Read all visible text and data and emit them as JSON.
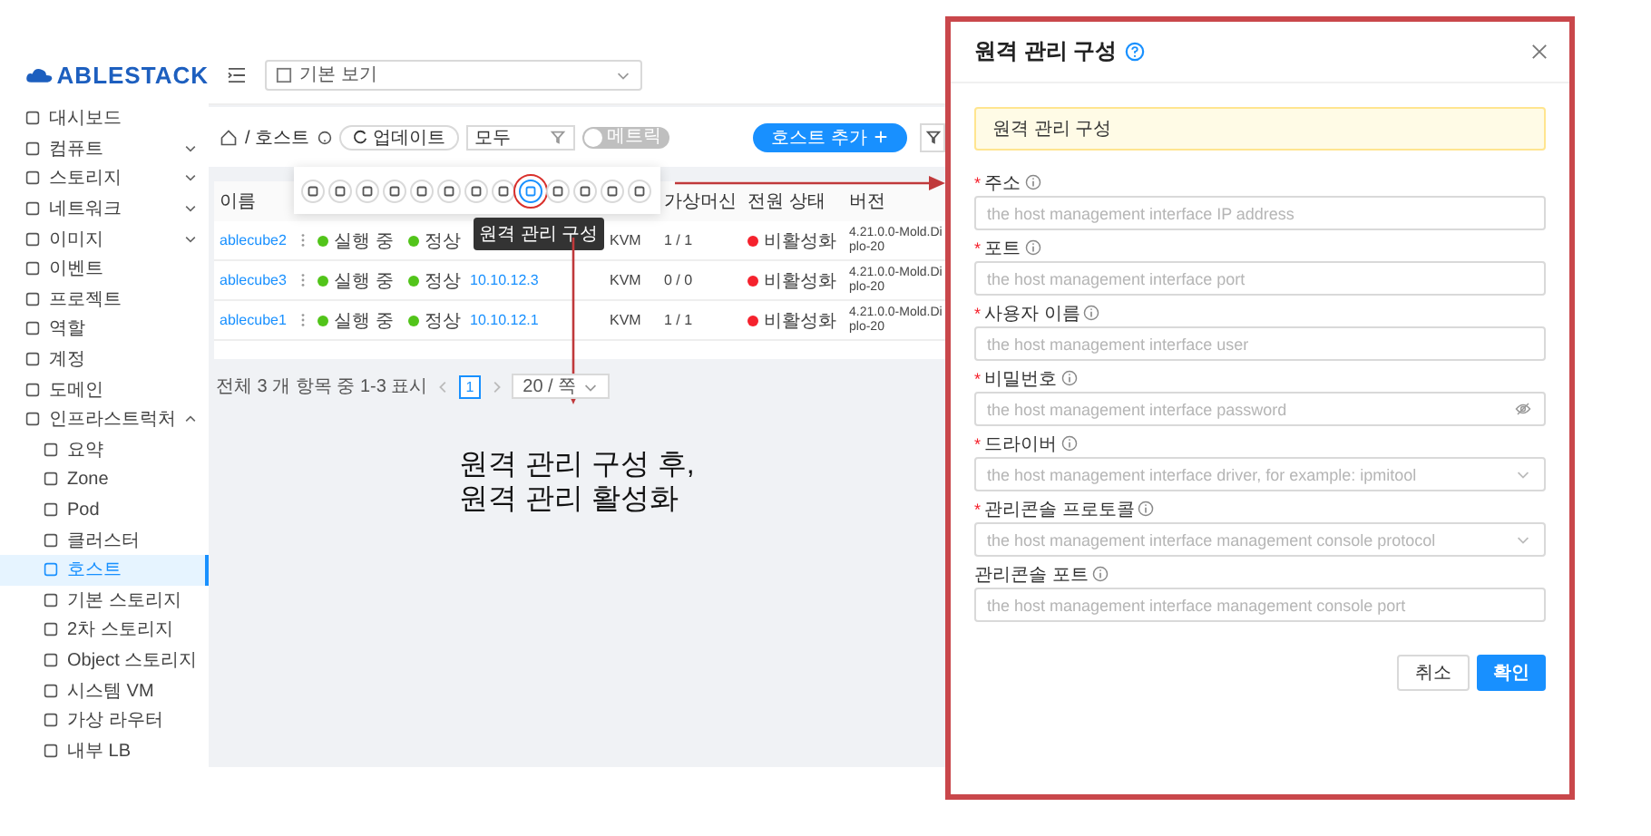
{
  "sidebar": {
    "logo": "ABLESTACK",
    "items": [
      {
        "label": "대시보드",
        "kind": "link",
        "selected": false
      },
      {
        "label": "컴퓨트",
        "kind": "group",
        "expanded": false,
        "selected": false
      },
      {
        "label": "스토리지",
        "kind": "group",
        "expanded": false,
        "selected": false
      },
      {
        "label": "네트워크",
        "kind": "group",
        "expanded": false,
        "selected": false
      },
      {
        "label": "이미지",
        "kind": "group",
        "expanded": false,
        "selected": false
      },
      {
        "label": "이벤트",
        "kind": "link",
        "selected": false
      },
      {
        "label": "프로젝트",
        "kind": "link",
        "selected": false
      },
      {
        "label": "역할",
        "kind": "link",
        "selected": false
      },
      {
        "label": "계정",
        "kind": "link",
        "selected": false
      },
      {
        "label": "도메인",
        "kind": "link",
        "selected": false
      },
      {
        "label": "인프라스트럭처",
        "kind": "group",
        "expanded": true,
        "selected": false,
        "children": [
          {
            "label": "요약",
            "selected": false
          },
          {
            "label": "Zone",
            "selected": false
          },
          {
            "label": "Pod",
            "selected": false
          },
          {
            "label": "클러스터",
            "selected": false
          },
          {
            "label": "호스트",
            "selected": true
          },
          {
            "label": "기본 스토리지",
            "selected": false
          },
          {
            "label": "2차 스토리지",
            "selected": false
          },
          {
            "label": "Object 스토리지",
            "selected": false
          },
          {
            "label": "시스템 VM",
            "selected": false
          },
          {
            "label": "가상 라우터",
            "selected": false
          },
          {
            "label": "내부 LB",
            "selected": false
          }
        ]
      }
    ]
  },
  "header": {
    "view_select": "기본 보기"
  },
  "toolbar": {
    "breadcrumb": "/ 호스트",
    "refresh_button": "업데이트",
    "filter_select": "모두",
    "metrics_toggle": {
      "label": "메트릭",
      "on": false
    },
    "add_button": "호스트 추가"
  },
  "table": {
    "columns": [
      "이름",
      "가상머신",
      "전원 상태",
      "버전"
    ],
    "rows": [
      {
        "name": "ablecube2",
        "state": {
          "text": "실행 중",
          "color": "#52c41a"
        },
        "resource": {
          "text": "정상",
          "color": "#52c41a"
        },
        "hypervisor": "KVM",
        "vms": "1 / 1",
        "power": {
          "text": "비활성화",
          "color": "#f5222d"
        },
        "version": "4.21.0.0-Mold.Diplo-20"
      },
      {
        "name": "ablecube3",
        "state": {
          "text": "실행 중",
          "color": "#52c41a"
        },
        "resource": {
          "text": "정상",
          "color": "#52c41a"
        },
        "ip": "10.10.12.3",
        "hypervisor": "KVM",
        "vms": "0 / 0",
        "power": {
          "text": "비활성화",
          "color": "#f5222d"
        },
        "version": "4.21.0.0-Mold.Diplo-20"
      },
      {
        "name": "ablecube1",
        "state": {
          "text": "실행 중",
          "color": "#52c41a"
        },
        "resource": {
          "text": "정상",
          "color": "#52c41a"
        },
        "ip": "10.10.12.1",
        "hypervisor": "KVM",
        "vms": "1 / 1",
        "power": {
          "text": "비활성화",
          "color": "#f5222d"
        },
        "version": "4.21.0.0-Mold.Diplo-20"
      }
    ]
  },
  "actions": {
    "buttons": [
      {
        "selected": false
      },
      {
        "selected": false
      },
      {
        "selected": false
      },
      {
        "selected": false
      },
      {
        "selected": false
      },
      {
        "selected": false
      },
      {
        "selected": false
      },
      {
        "selected": false
      },
      {
        "selected": true
      },
      {
        "selected": false
      },
      {
        "selected": false
      },
      {
        "selected": false
      },
      {
        "selected": false
      }
    ],
    "tooltip": "원격 관리 구성"
  },
  "pagination": {
    "summary": "전체 3 개 항목 중 1-3 표시",
    "pages": [
      {
        "label": "1",
        "selected": true
      }
    ],
    "page_size": "20 / 쪽"
  },
  "annotation": {
    "lines": [
      "원격 관리 구성 후,",
      "원격 관리 활성화"
    ]
  },
  "dialog": {
    "title": "원격 관리 구성",
    "alert": "원격 관리 구성",
    "fields": [
      {
        "label": "주소",
        "required_mark": "*",
        "kind": "input",
        "placeholder": "the host management interface IP address"
      },
      {
        "label": "포트",
        "required_mark": "*",
        "kind": "input",
        "placeholder": "the host management interface port"
      },
      {
        "label": "사용자 이름",
        "required_mark": "*",
        "kind": "input",
        "placeholder": "the host management interface user"
      },
      {
        "label": "비밀번호",
        "required_mark": "*",
        "kind": "password",
        "placeholder": "the host management interface password"
      },
      {
        "label": "드라이버",
        "required_mark": "*",
        "kind": "select",
        "placeholder": "the host management interface driver, for example: ipmitool"
      },
      {
        "label": "관리콘솔 프로토콜",
        "required_mark": "*",
        "kind": "select",
        "placeholder": "the host management interface management console protocol"
      },
      {
        "label": "관리콘솔 포트",
        "kind": "input",
        "placeholder": "the host management interface management console port"
      }
    ],
    "cancel_button": "취소",
    "ok_button": "확인"
  }
}
